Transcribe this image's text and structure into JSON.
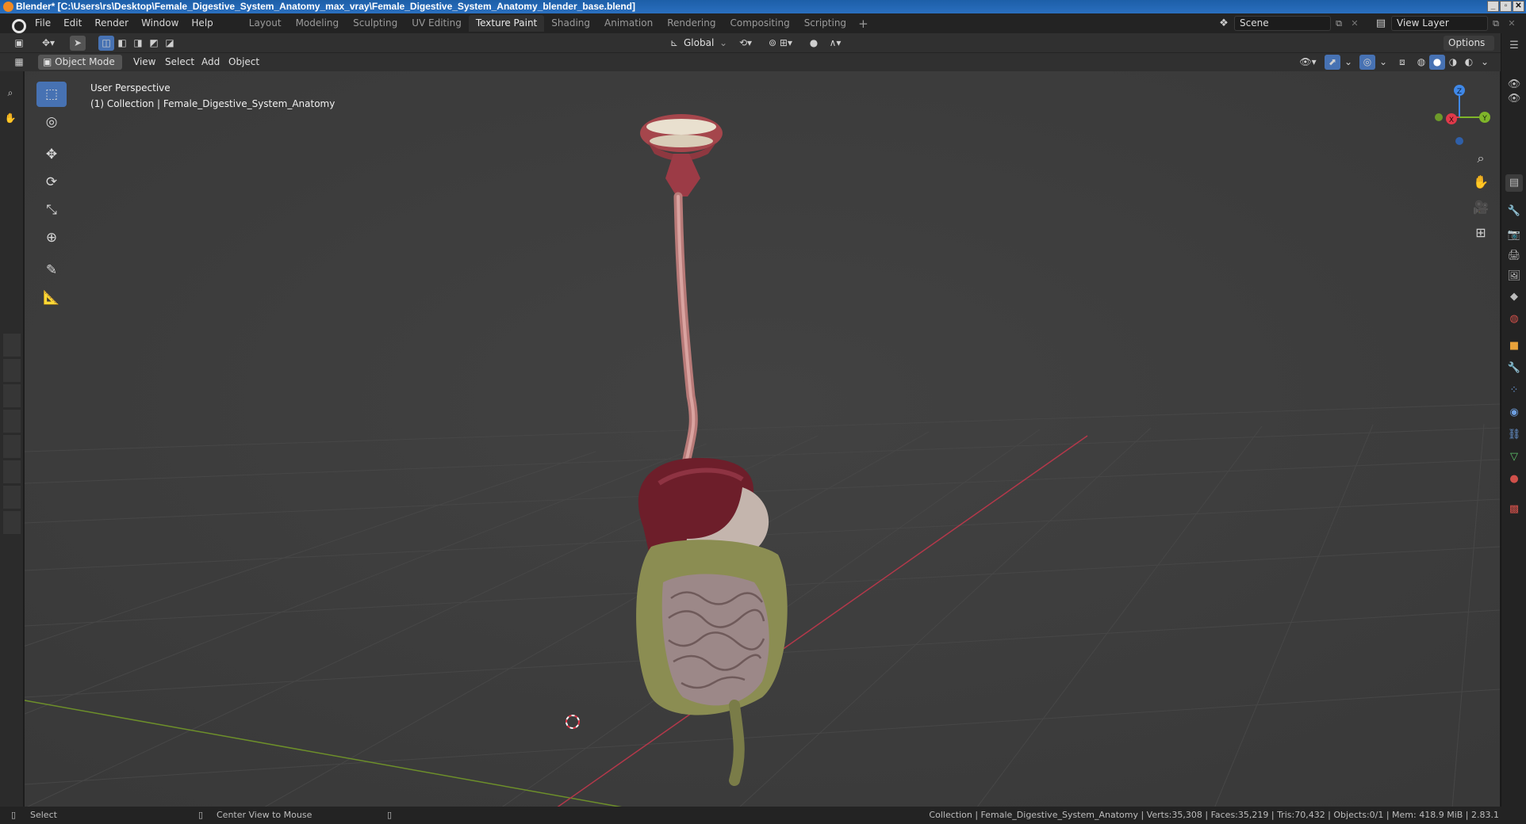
{
  "window": {
    "title": "Blender* [C:\\Users\\rs\\Desktop\\Female_Digestive_System_Anatomy_max_vray\\Female_Digestive_System_Anatomy_blender_base.blend]",
    "controls": [
      "_",
      "▫",
      "✕"
    ]
  },
  "menubar": {
    "items": [
      "File",
      "Edit",
      "Render",
      "Window",
      "Help"
    ]
  },
  "workspaces": {
    "tabs": [
      "Layout",
      "Modeling",
      "Sculpting",
      "UV Editing",
      "Texture Paint",
      "Shading",
      "Animation",
      "Rendering",
      "Compositing",
      "Scripting"
    ],
    "active": "Texture Paint",
    "add_label": "+"
  },
  "scene": {
    "name": "Scene"
  },
  "view_layer": {
    "name": "View Layer"
  },
  "tool_header": {
    "orientation": "Global",
    "options_label": "Options"
  },
  "viewport_header": {
    "mode": "Object Mode",
    "menus": [
      "View",
      "Select",
      "Add",
      "Object"
    ]
  },
  "viewport": {
    "perspective_label": "User Perspective",
    "collection_label": "(1) Collection | Female_Digestive_System_Anatomy",
    "gizmo_axes": {
      "x": "X",
      "y": "Y",
      "z": "Z"
    }
  },
  "colors": {
    "accent": "#4772b3",
    "x_axis": "#e0394a",
    "y_axis": "#7fb52a",
    "z_axis": "#3f88e8",
    "viewport_bg": "#3d3d3d"
  },
  "toolbar": {
    "tools": [
      "select-box-icon",
      "cursor-icon",
      "move-icon",
      "rotate-icon",
      "scale-icon",
      "transform-icon",
      "annotate-icon",
      "measure-icon"
    ],
    "active": "select-box-icon"
  },
  "statusbar": {
    "left_action": "Select",
    "middle_action": "Center View to Mouse",
    "stats": "Collection | Female_Digestive_System_Anatomy | Verts:35,308 | Faces:35,219 | Tris:70,432 | Objects:0/1 | Mem: 418.9 MiB | 2.83.1"
  }
}
